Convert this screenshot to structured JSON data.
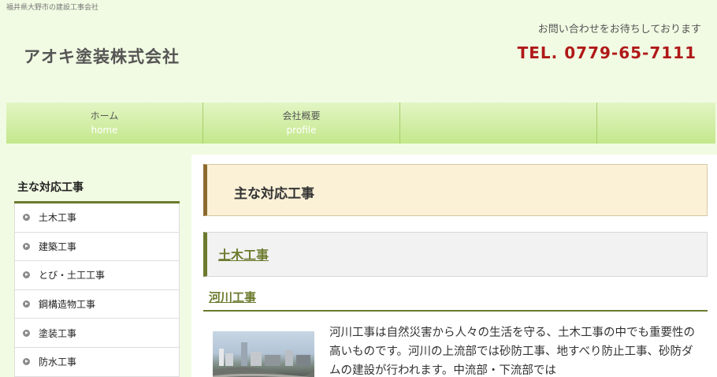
{
  "header": {
    "tagline": "福井県大野市の建設工事会社",
    "company": "アオキ塗装株式会社",
    "contact_message": "お問い合わせをお待ちしております",
    "tel": "TEL. 0779-65-7111"
  },
  "nav": [
    {
      "ja": "ホーム",
      "en": "home"
    },
    {
      "ja": "会社概要",
      "en": "profile"
    }
  ],
  "sidebar": {
    "title": "主な対応工事",
    "items": [
      "土木工事",
      "建築工事",
      "とび・土工工事",
      "鋼構造物工事",
      "塗装工事",
      "防水工事"
    ]
  },
  "main": {
    "page_title": "主な対応工事",
    "section_heading": "土木工事",
    "sub_heading": "河川工事",
    "paragraph": "河川工事は自然災害から人々の生活を守る、土木工事の中でも重要性の高いものです。河川の上流部では砂防工事、地すべり防止工事、砂防ダムの建設が行われます。中流部・下流部では"
  },
  "colors": {
    "background": "#f1fbe3",
    "nav_gradient_top": "#e2f5c4",
    "nav_gradient_bottom": "#c4e88c",
    "accent_olive": "#6b7a2e",
    "tel_red": "#b01919",
    "title_box_bg": "#faf1d7",
    "title_box_border": "#8c6a2f"
  },
  "icons": {
    "sidebar_bullet": "circle-arrow-right-icon"
  }
}
